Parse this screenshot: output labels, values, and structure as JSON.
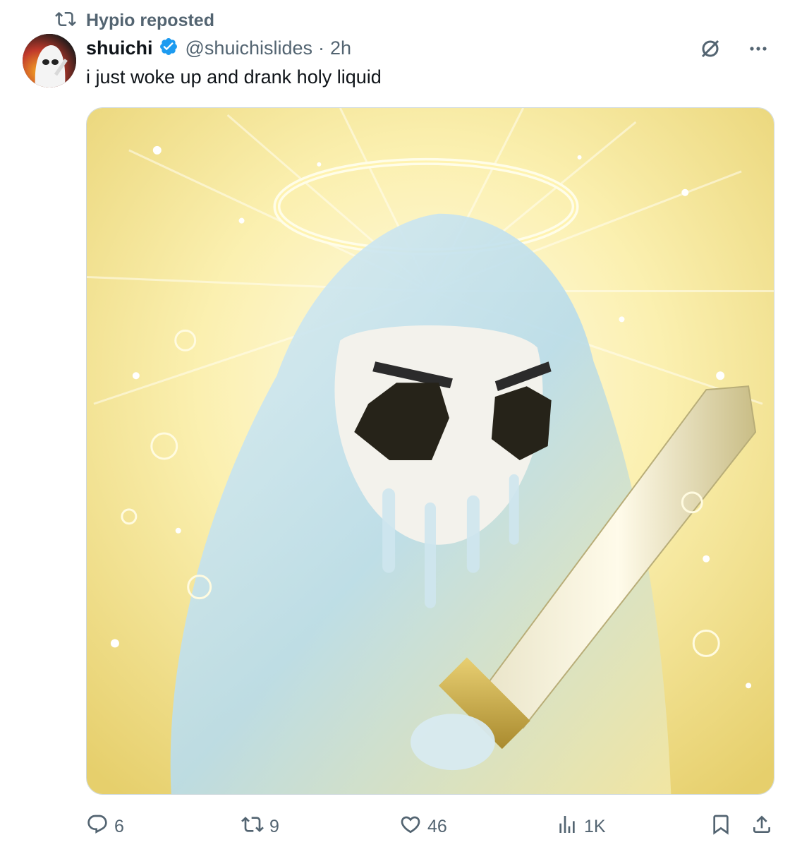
{
  "repost": {
    "text": "Hypio reposted",
    "icon": "repost-icon"
  },
  "author": {
    "display_name": "shuichi",
    "handle": "@shuichislides",
    "separator": "·",
    "time": "2h",
    "verified_icon": "verified-badge-icon"
  },
  "tweet": {
    "text": "i just woke up and drank holy liquid"
  },
  "media": {
    "description_icon": "ghost-angel-with-sword-image"
  },
  "actions": {
    "reply_count": "6",
    "repost_count": "9",
    "like_count": "46",
    "views_count": "1K"
  },
  "colors": {
    "secondary_text": "#536471",
    "accent": "#1d9bf0",
    "primary_text": "#0f1419",
    "border": "#cfd9de"
  }
}
